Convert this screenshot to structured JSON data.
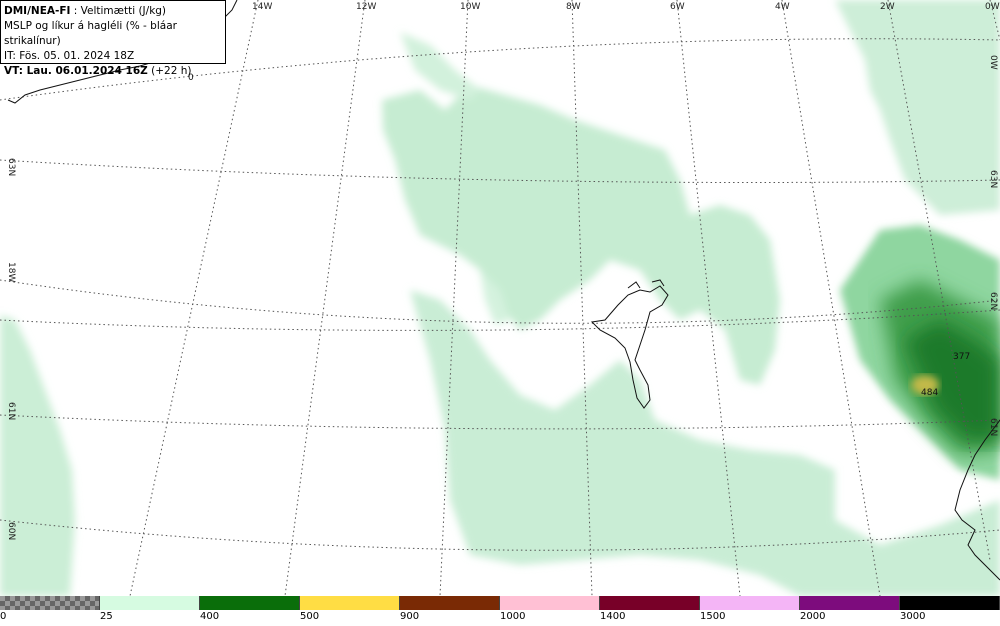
{
  "info": {
    "title_bold": "DMI/NEA-FI",
    "title_rest": " : Veltimætti (J/kg)",
    "line2": "MSLP og líkur á hagléli (% - bláar strikalínur)",
    "line3": "IT: Fös. 05. 01. 2024 18Z",
    "line4_bold": "VT: Lau. 06.01.2024 16Z",
    "line4_rest": " (+22 h)"
  },
  "lon_labels": [
    "14W",
    "12W",
    "10W",
    "8W",
    "6W",
    "4W",
    "2W",
    "0W"
  ],
  "lat_labels_left": [
    "63N",
    "18W",
    "61N",
    "60N"
  ],
  "lat_labels_right": [
    "0W",
    "63N",
    "62N",
    "61N"
  ],
  "map_values": [
    "0",
    "377",
    "484"
  ],
  "colorbar": {
    "colors": [
      "#d6fbe1",
      "#0a6e0a",
      "#ffdd44",
      "#7a2a05",
      "#ffc0d4",
      "#780028",
      "#f4b5f6",
      "#7d0c7d",
      "#000000"
    ],
    "labels": [
      "0",
      "25",
      "400",
      "500",
      "900",
      "1000",
      "1400",
      "1500",
      "2000",
      "3000"
    ]
  }
}
